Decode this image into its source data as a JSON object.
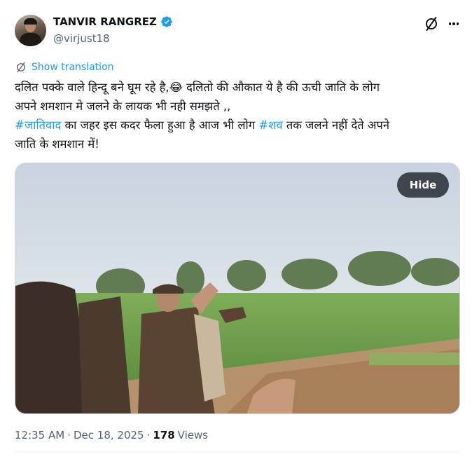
{
  "author": {
    "display_name": "TANVIR RANGREZ",
    "handle": "@virjust18",
    "verified": true
  },
  "actions": {
    "grok_icon": "grok-icon",
    "more_icon": "more-icon"
  },
  "translation": {
    "label": "Show translation",
    "icon": "translate-icon"
  },
  "tweet": {
    "line1_part1": "दलित पक्के वाले हिन्दू बने घूम रहे है,",
    "emoji": "😂",
    "line1_part2": " दलितो की औकात ये है की ऊची जाति के लोग",
    "line2": "अपने शमशान मे जलने के लायक भी नही समझते ,,",
    "hashtag1": "#जातिवाद",
    "line3_part1": " का जहर इस कदर फैला हुआ है आज भी लोग ",
    "hashtag2": "#शव",
    "line3_part2": " तक जलने नहीं देते अपने",
    "line4": "जाति के शमशान में!"
  },
  "media": {
    "hide_label": "Hide"
  },
  "meta": {
    "time": "12:35 AM",
    "sep1": "·",
    "date": "Dec 18, 2025",
    "sep2": "·",
    "views_count": "178",
    "views_label": "Views"
  },
  "colors": {
    "accent": "#1d9bf0",
    "text": "#0f1419",
    "muted": "#536471"
  }
}
